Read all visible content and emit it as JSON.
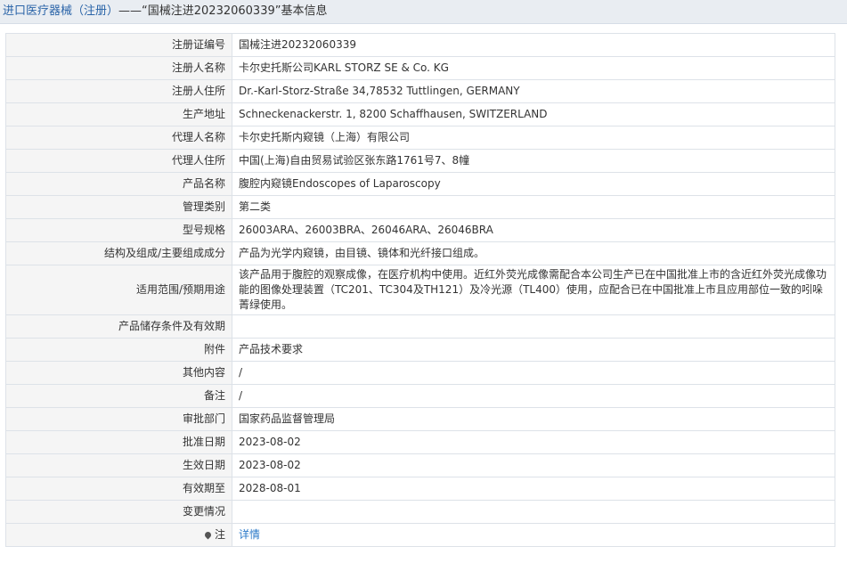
{
  "header": {
    "title_link": "进口医疗器械（注册）",
    "title_suffix": "——“国械注进20232060339”基本信息"
  },
  "rows": [
    {
      "label": "注册证编号",
      "value": "国械注进20232060339"
    },
    {
      "label": "注册人名称",
      "value": "卡尔史托斯公司KARL STORZ SE & Co. KG"
    },
    {
      "label": "注册人住所",
      "value": "Dr.-Karl-Storz-Straße 34,78532 Tuttlingen, GERMANY"
    },
    {
      "label": "生产地址",
      "value": "Schneckenackerstr. 1, 8200 Schaffhausen, SWITZERLAND"
    },
    {
      "label": "代理人名称",
      "value": "卡尔史托斯内窥镜（上海）有限公司"
    },
    {
      "label": "代理人住所",
      "value": "中国(上海)自由贸易试验区张东路1761号7、8幢"
    },
    {
      "label": "产品名称",
      "value": "腹腔内窥镜Endoscopes of Laparoscopy"
    },
    {
      "label": "管理类别",
      "value": "第二类"
    },
    {
      "label": "型号规格",
      "value": "26003ARA、26003BRA、26046ARA、26046BRA"
    },
    {
      "label": "结构及组成/主要组成成分",
      "value": "产品为光学内窥镜，由目镜、镜体和光纤接口组成。"
    },
    {
      "label": "适用范围/预期用途",
      "value": "该产品用于腹腔的观察成像，在医疗机构中使用。近红外荧光成像需配合本公司生产已在中国批准上市的含近红外荧光成像功能的图像处理装置（TC201、TC304及TH121）及冷光源（TL400）使用，应配合已在中国批准上市且应用部位一致的吲哚菁绿使用。"
    },
    {
      "label": "产品储存条件及有效期",
      "value": ""
    },
    {
      "label": "附件",
      "value": "产品技术要求"
    },
    {
      "label": "其他内容",
      "value": "/"
    },
    {
      "label": "备注",
      "value": "/"
    },
    {
      "label": "审批部门",
      "value": "国家药品监督管理局"
    },
    {
      "label": "批准日期",
      "value": "2023-08-02"
    },
    {
      "label": "生效日期",
      "value": "2023-08-02"
    },
    {
      "label": "有效期至",
      "value": "2028-08-01"
    },
    {
      "label": "变更情况",
      "value": ""
    }
  ],
  "note_row": {
    "label": "注",
    "link_text": "详情",
    "icon": "pin-icon"
  }
}
